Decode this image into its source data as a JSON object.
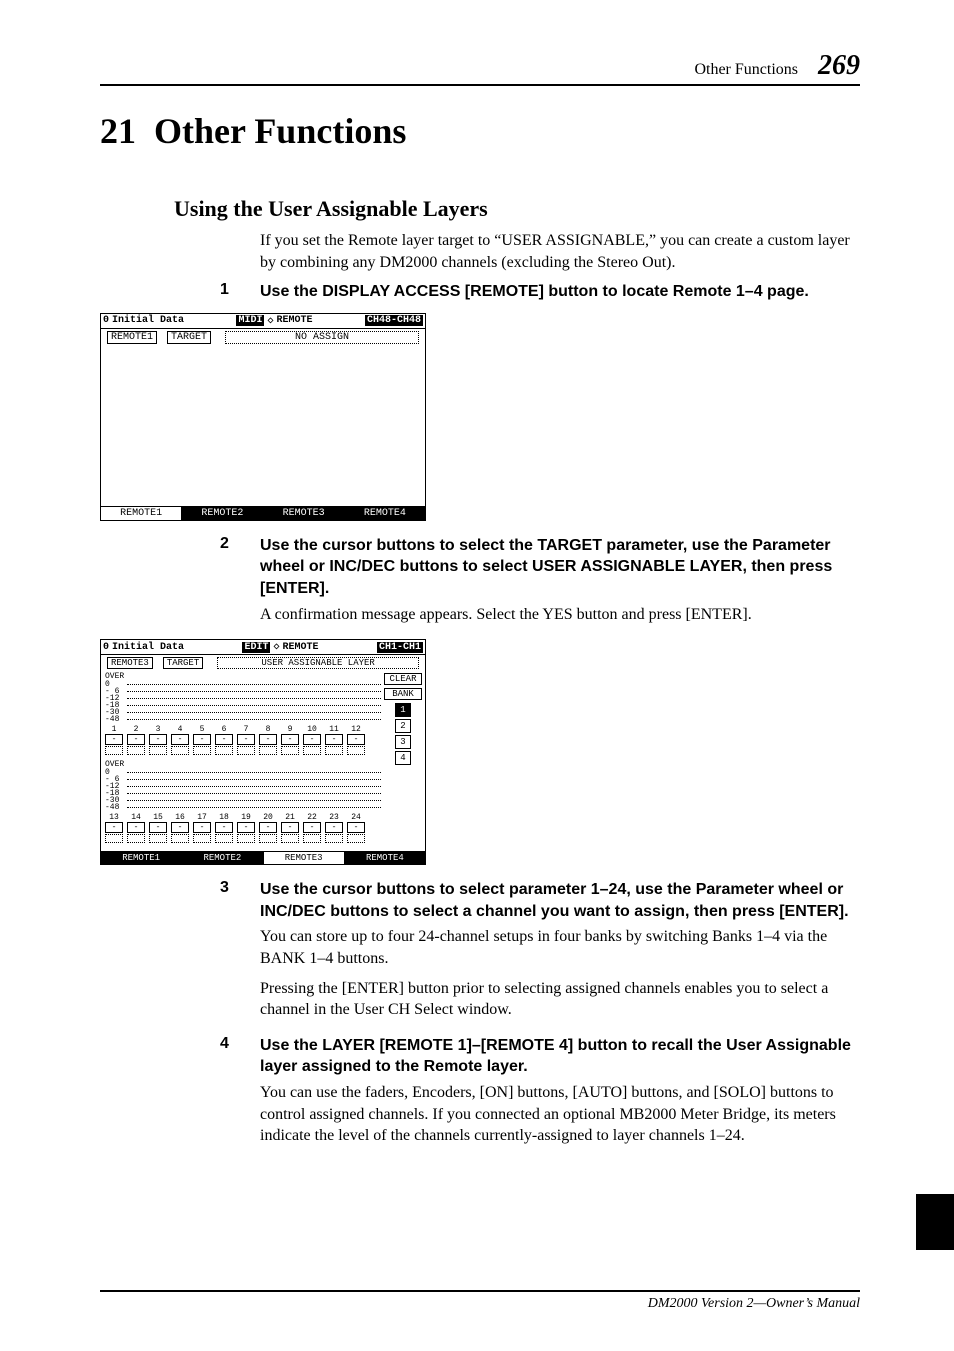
{
  "header": {
    "title": "Other Functions",
    "page_number": "269"
  },
  "chapter": {
    "number": "21",
    "title": "Other Functions"
  },
  "section": {
    "title": "Using the User Assignable Layers"
  },
  "intro": "If you set the Remote layer target to “USER ASSIGNABLE,” you can create a custom layer by combining any DM2000 channels (excluding the Stereo Out).",
  "steps": [
    {
      "num": "1",
      "head": "Use the DISPLAY ACCESS [REMOTE] button to locate Remote 1–4 page."
    },
    {
      "num": "2",
      "head": "Use the cursor buttons to select the TARGET parameter, use the Parameter wheel or INC/DEC buttons to select USER ASSIGNABLE LAYER, then press [ENTER].",
      "para": "A confirmation message appears. Select the YES button and press [ENTER]."
    },
    {
      "num": "3",
      "head": "Use the cursor buttons to select parameter 1–24, use the Parameter wheel or INC/DEC buttons to select a channel you want to assign, then press [ENTER].",
      "para1": "You can store up to four 24-channel setups in four banks by switching Banks 1–4 via the BANK 1–4 buttons.",
      "para2": "Pressing the [ENTER] button prior to selecting assigned channels enables you to select a channel in the User CH Select window."
    },
    {
      "num": "4",
      "head": "Use the LAYER [REMOTE 1]–[REMOTE 4] button to recall the User Assignable layer assigned to the Remote layer.",
      "para": "You can use the faders, Encoders, [ON] buttons, [AUTO] buttons, and [SOLO] buttons to control assigned channels. If you connected an optional MB2000 Meter Bridge, its meters indicate the level of the channels currently-assigned to layer channels 1–24."
    }
  ],
  "lcd1": {
    "scene_num": "0",
    "scene_name": "Initial Data",
    "edit_flag": "MIDI",
    "page_name": "REMOTE",
    "ch_range": "CH48-CH48",
    "subpage": "REMOTE1",
    "target_label": "TARGET",
    "target_value": "NO ASSIGN",
    "tabs": [
      "REMOTE1",
      "REMOTE2",
      "REMOTE3",
      "REMOTE4"
    ],
    "active_tab": 0
  },
  "lcd2": {
    "scene_num": "0",
    "scene_name": "Initial Data",
    "edit_flag": "EDIT",
    "page_name": "REMOTE",
    "ch_range": "CH1-CH1",
    "subpage": "REMOTE3",
    "target_label": "TARGET",
    "target_value": "USER ASSIGNABLE LAYER",
    "meter_label": "OVER",
    "meter_ticks": [
      "0",
      "- 6",
      "-12",
      "-18",
      "-30",
      "-48"
    ],
    "ch_top": [
      "1",
      "2",
      "3",
      "4",
      "5",
      "6",
      "7",
      "8",
      "9",
      "10",
      "11",
      "12"
    ],
    "ch_bottom": [
      "13",
      "14",
      "15",
      "16",
      "17",
      "18",
      "19",
      "20",
      "21",
      "22",
      "23",
      "24"
    ],
    "clear": "CLEAR",
    "bank": "BANK",
    "bank_nums": [
      "1",
      "2",
      "3",
      "4"
    ],
    "active_bank": 0,
    "tabs": [
      "REMOTE1",
      "REMOTE2",
      "REMOTE3",
      "REMOTE4"
    ],
    "active_tab": 2
  },
  "footer": "DM2000 Version 2—Owner’s Manual"
}
